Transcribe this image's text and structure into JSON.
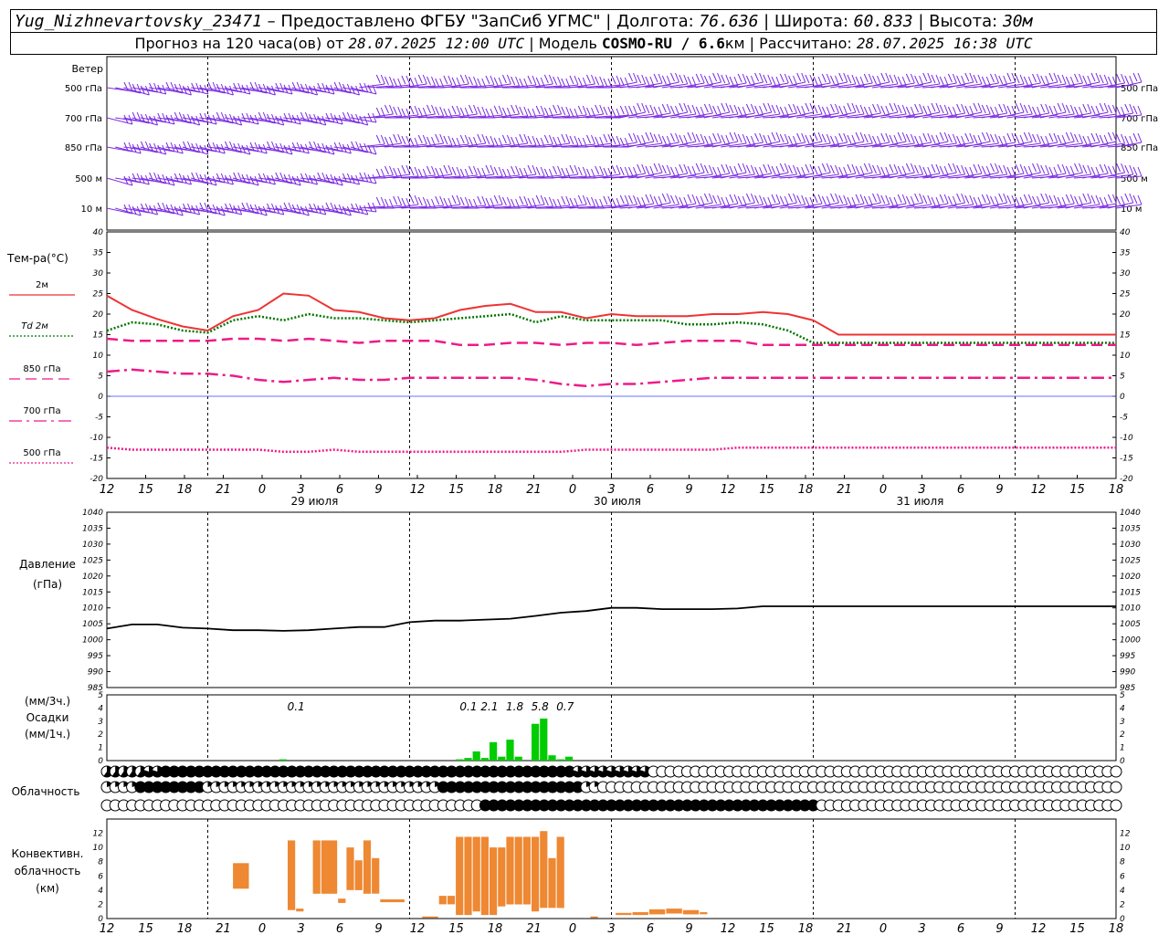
{
  "header": {
    "station": "Yug_Nizhnevartovsky_23471",
    "provider_sep": " – Предоставлено ФГБУ \"ЗапСиб УГМС\" | Долгота: ",
    "lon": "76.636",
    "lat_label": " | Широта: ",
    "lat": "60.833",
    "alt_label": " | Высота: ",
    "alt": "30м",
    "forecast_label": "Прогноз на 120 часа(ов) от ",
    "forecast_from": "28.07.2025 12:00 UTC",
    "model_label": "  | Модель ",
    "model": "COSMO-RU / 6.6",
    "model_unit": "км",
    "calc_label": " | Рассчитано: ",
    "calc_time": "28.07.2025 16:38 UTC"
  },
  "chart_data": [
    {
      "type": "line",
      "panel": "wind",
      "title": "Ветер",
      "levels": [
        "500 гПа",
        "700 гПа",
        "850 гПа",
        "500 м",
        "10  м"
      ]
    },
    {
      "type": "line",
      "panel": "temperature",
      "ylabel": "Тем-ра(°C)",
      "ylim": [
        -20,
        40
      ],
      "yticks": [
        40,
        35,
        30,
        25,
        20,
        15,
        10,
        5,
        0,
        -5,
        -10,
        -15,
        -20
      ],
      "x_hours": [
        0,
        3,
        6,
        9,
        12,
        15,
        18,
        21,
        24,
        27,
        30,
        33,
        36,
        39,
        42,
        45,
        48,
        51,
        54,
        57,
        60,
        63,
        66,
        69,
        72,
        75,
        78,
        81,
        84,
        87,
        90,
        93,
        96,
        99,
        102,
        105,
        108,
        111,
        114,
        117,
        120
      ],
      "x_tick_labels": [
        "12",
        "15",
        "18",
        "21",
        "0",
        "3",
        "6",
        "9",
        "12",
        "15",
        "18",
        "21",
        "0",
        "3",
        "6",
        "9",
        "12",
        "15",
        "18",
        "21",
        "0",
        "3",
        "6",
        "9",
        "12",
        "15",
        "18"
      ],
      "date_labels": [
        "29 июля",
        "30 июля",
        "31 июля"
      ],
      "series": [
        {
          "name": "2м",
          "color": "#ee3333",
          "style": "solid",
          "values": [
            24.5,
            21,
            18.8,
            17,
            16,
            19.5,
            21,
            25,
            24.5,
            21,
            20.5,
            19,
            18.5,
            19,
            21,
            22,
            22.5,
            20.5,
            20.5,
            19,
            20,
            19.5,
            19.5,
            19.5,
            20,
            20,
            20.5,
            20,
            18.5,
            15,
            15,
            15,
            15,
            15,
            15,
            15,
            15,
            15,
            15,
            15,
            15
          ]
        },
        {
          "name": "Td 2м",
          "color": "#007700",
          "style": "dotted",
          "values": [
            16,
            18,
            17.5,
            16,
            15.5,
            18.5,
            19.5,
            18.5,
            20,
            19,
            19,
            18.5,
            18,
            18.5,
            19,
            19.5,
            20,
            18,
            19.5,
            18.5,
            18.5,
            18.5,
            18.5,
            17.5,
            17.5,
            18,
            17.5,
            16,
            13,
            13,
            13,
            13,
            13,
            13,
            13,
            13,
            13,
            13,
            13,
            13,
            13
          ]
        },
        {
          "name": "850 гПа",
          "color": "#ee1a8a",
          "style": "dashed",
          "values": [
            14,
            13.5,
            13.5,
            13.5,
            13.5,
            14,
            14,
            13.5,
            14,
            13.5,
            13,
            13.5,
            13.5,
            13.5,
            12.5,
            12.5,
            13,
            13,
            12.5,
            13,
            13,
            12.5,
            13,
            13.5,
            13.5,
            13.5,
            12.5,
            12.5,
            12.5,
            12.5,
            12.5,
            12.5,
            12.5,
            12.5,
            12.5,
            12.5,
            12.5,
            12.5,
            12.5,
            12.5,
            12.5
          ]
        },
        {
          "name": "700 гПа",
          "color": "#ee1a8a",
          "style": "dashdot",
          "values": [
            6,
            6.5,
            6,
            5.5,
            5.5,
            5,
            4,
            3.5,
            4,
            4.5,
            4,
            4,
            4.5,
            4.5,
            4.5,
            4.5,
            4.5,
            4,
            3,
            2.5,
            3,
            3,
            3.5,
            4,
            4.5,
            4.5,
            4.5,
            4.5,
            4.5,
            4.5,
            4.5,
            4.5,
            4.5,
            4.5,
            4.5,
            4.5,
            4.5,
            4.5,
            4.5,
            4.5,
            4.5
          ]
        },
        {
          "name": "500 гПа",
          "color": "#ee1a8a",
          "style": "dotted",
          "values": [
            -12.5,
            -13,
            -13,
            -13,
            -13,
            -13,
            -13,
            -13.5,
            -13.5,
            -13,
            -13.5,
            -13.5,
            -13.5,
            -13.5,
            -13.5,
            -13.5,
            -13.5,
            -13.5,
            -13.5,
            -13,
            -13,
            -13,
            -13,
            -13,
            -13,
            -12.5,
            -12.5,
            -12.5,
            -12.5,
            -12.5,
            -12.5,
            -12.5,
            -12.5,
            -12.5,
            -12.5,
            -12.5,
            -12.5,
            -12.5,
            -12.5,
            -12.5,
            -12.5
          ]
        }
      ]
    },
    {
      "type": "line",
      "panel": "pressure",
      "ylabel": "Давление",
      "yunit": "(гПа)",
      "ylim": [
        985,
        1040
      ],
      "yticks": [
        1040,
        1035,
        1030,
        1025,
        1020,
        1015,
        1010,
        1005,
        1000,
        995,
        990,
        985
      ],
      "series": [
        {
          "name": "Давление",
          "color": "#000000",
          "values": [
            1003.5,
            1004.8,
            1004.8,
            1003.8,
            1003.5,
            1003,
            1003,
            1002.8,
            1003,
            1003.5,
            1004,
            1004,
            1005.5,
            1006,
            1006,
            1006.3,
            1006.6,
            1007.5,
            1008.5,
            1009,
            1010,
            1010,
            1009.6,
            1009.6,
            1009.6,
            1009.8,
            1010.5,
            1010.5,
            1010.5,
            1010.5,
            1010.5,
            1010.5,
            1010.5,
            1010.5,
            1010.5,
            1010.5,
            1010.5,
            1010.5,
            1010.5,
            1010.5,
            1010.5
          ]
        }
      ]
    },
    {
      "type": "bar",
      "panel": "precipitation",
      "ylabel": "Осадки",
      "yunit_top": "(мм/3ч.)",
      "yunit_bottom": "(мм/1ч.)",
      "ylim": [
        0,
        5
      ],
      "yticks": [
        5,
        4,
        3,
        2,
        1,
        0
      ],
      "color": "#00cc00",
      "bars_hourly": [
        {
          "hour": 21,
          "value": 0.1
        },
        {
          "hour": 42,
          "value": 0.1
        },
        {
          "hour": 43,
          "value": 0.2
        },
        {
          "hour": 44,
          "value": 0.7
        },
        {
          "hour": 45,
          "value": 0.2
        },
        {
          "hour": 46,
          "value": 1.4
        },
        {
          "hour": 47,
          "value": 0.3
        },
        {
          "hour": 48,
          "value": 1.6
        },
        {
          "hour": 49,
          "value": 0.3
        },
        {
          "hour": 51,
          "value": 2.8
        },
        {
          "hour": 52,
          "value": 3.2
        },
        {
          "hour": 53,
          "value": 0.4
        },
        {
          "hour": 54,
          "value": 0.1
        },
        {
          "hour": 55,
          "value": 0.3
        }
      ],
      "totals_3h": [
        {
          "hour": 22.5,
          "label": "0.1"
        },
        {
          "hour": 43,
          "label": "0.1"
        },
        {
          "hour": 45.5,
          "label": "2.1"
        },
        {
          "hour": 48.5,
          "label": "1.8"
        },
        {
          "hour": 51.5,
          "label": "5.8"
        },
        {
          "hour": 54.5,
          "label": "0.7"
        }
      ]
    },
    {
      "type": "table",
      "panel": "cloud_cover",
      "ylabel": "Облачность",
      "rows": 3
    },
    {
      "type": "bar",
      "panel": "convective_cloud",
      "ylabel_lines": [
        "Конвективн.",
        "облачность",
        "(км)"
      ],
      "ylim": [
        0,
        14
      ],
      "yticks": [
        12,
        10,
        8,
        6,
        4,
        2,
        0
      ],
      "color": "#ee8833",
      "bars": [
        {
          "x0": 15.0,
          "x1": 17.0,
          "base": 4.2,
          "top": 7.8
        },
        {
          "x0": 21.5,
          "x1": 22.5,
          "base": 1.2,
          "top": 11.0
        },
        {
          "x0": 22.5,
          "x1": 23.5,
          "base": 1.0,
          "top": 1.4
        },
        {
          "x0": 24.5,
          "x1": 25.5,
          "base": 3.5,
          "top": 11.0
        },
        {
          "x0": 25.5,
          "x1": 27.5,
          "base": 3.5,
          "top": 11.0
        },
        {
          "x0": 27.5,
          "x1": 28.5,
          "base": 2.2,
          "top": 2.8
        },
        {
          "x0": 28.5,
          "x1": 29.5,
          "base": 4.0,
          "top": 10.0
        },
        {
          "x0": 29.5,
          "x1": 30.5,
          "base": 4.0,
          "top": 8.2
        },
        {
          "x0": 30.5,
          "x1": 31.5,
          "base": 3.5,
          "top": 11.0
        },
        {
          "x0": 31.5,
          "x1": 32.5,
          "base": 3.5,
          "top": 8.5
        },
        {
          "x0": 32.5,
          "x1": 35.5,
          "base": 2.3,
          "top": 2.7
        },
        {
          "x0": 37.5,
          "x1": 39.5,
          "base": 0.1,
          "top": 0.3
        },
        {
          "x0": 39.5,
          "x1": 40.5,
          "base": 2.0,
          "top": 3.2
        },
        {
          "x0": 40.5,
          "x1": 41.5,
          "base": 2.0,
          "top": 3.2
        },
        {
          "x0": 41.5,
          "x1": 42.5,
          "base": 0.5,
          "top": 11.5
        },
        {
          "x0": 42.5,
          "x1": 43.5,
          "base": 0.5,
          "top": 11.5
        },
        {
          "x0": 43.5,
          "x1": 44.5,
          "base": 1.0,
          "top": 11.5
        },
        {
          "x0": 44.5,
          "x1": 45.5,
          "base": 0.5,
          "top": 11.5
        },
        {
          "x0": 45.5,
          "x1": 46.5,
          "base": 0.5,
          "top": 10.0
        },
        {
          "x0": 46.5,
          "x1": 47.5,
          "base": 1.7,
          "top": 10.0
        },
        {
          "x0": 47.5,
          "x1": 48.5,
          "base": 2.0,
          "top": 11.5
        },
        {
          "x0": 48.5,
          "x1": 49.5,
          "base": 2.0,
          "top": 11.5
        },
        {
          "x0": 49.5,
          "x1": 50.5,
          "base": 2.0,
          "top": 11.5
        },
        {
          "x0": 50.5,
          "x1": 51.5,
          "base": 1.0,
          "top": 11.5
        },
        {
          "x0": 51.5,
          "x1": 52.5,
          "base": 1.5,
          "top": 12.3
        },
        {
          "x0": 52.5,
          "x1": 53.5,
          "base": 1.5,
          "top": 8.5
        },
        {
          "x0": 53.5,
          "x1": 54.5,
          "base": 1.5,
          "top": 11.5
        },
        {
          "x0": 57.5,
          "x1": 58.5,
          "base": 0.1,
          "top": 0.3
        },
        {
          "x0": 60.5,
          "x1": 62.5,
          "base": 0.5,
          "top": 0.8
        },
        {
          "x0": 62.5,
          "x1": 64.5,
          "base": 0.5,
          "top": 0.9
        },
        {
          "x0": 64.5,
          "x1": 66.5,
          "base": 0.6,
          "top": 1.3
        },
        {
          "x0": 66.5,
          "x1": 68.5,
          "base": 0.7,
          "top": 1.4
        },
        {
          "x0": 68.5,
          "x1": 70.5,
          "base": 0.6,
          "top": 1.2
        },
        {
          "x0": 70.5,
          "x1": 71.5,
          "base": 0.6,
          "top": 0.9
        }
      ]
    }
  ]
}
